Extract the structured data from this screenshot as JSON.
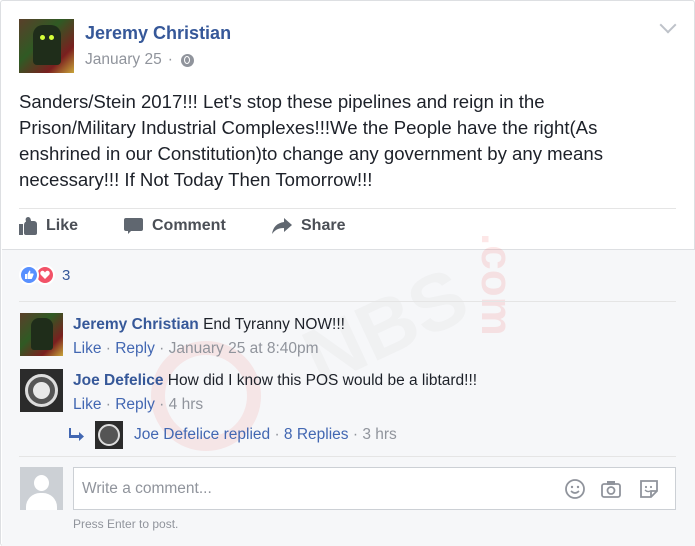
{
  "post": {
    "author": "Jeremy Christian",
    "date": "January 25",
    "separator": "·",
    "text": "Sanders/Stein 2017!!! Let's stop these pipelines and reign in the Prison/Military Industrial Complexes!!!We the People have the right(As enshrined in our Constitution)to change any government by any means necessary!!! If Not Today Then Tomorrow!!!"
  },
  "actions": {
    "like": "Like",
    "comment": "Comment",
    "share": "Share"
  },
  "reactions": {
    "count": "3",
    "types": [
      "like",
      "love"
    ],
    "like_color": "#5890ff",
    "love_color": "#f25268"
  },
  "comments": [
    {
      "author": "Jeremy Christian",
      "text": "End Tyranny NOW!!!",
      "like": "Like",
      "reply": "Reply",
      "time": "January 25 at 8:40pm"
    },
    {
      "author": "Joe Defelice",
      "text": "How did I know this POS would be a libtard!!!",
      "like": "Like",
      "reply": "Reply",
      "time": "4 hrs"
    }
  ],
  "reply_summary": {
    "author": "Joe Defelice",
    "action": "replied",
    "count": "8 Replies",
    "time": "3 hrs"
  },
  "composer": {
    "placeholder": "Write a comment...",
    "hint": "Press Enter to post.",
    "icons": [
      "emoji-icon",
      "camera-icon",
      "sticker-icon"
    ]
  },
  "colors": {
    "link": "#365899",
    "muted": "#90949c",
    "lower_bg": "#f6f7f9"
  }
}
